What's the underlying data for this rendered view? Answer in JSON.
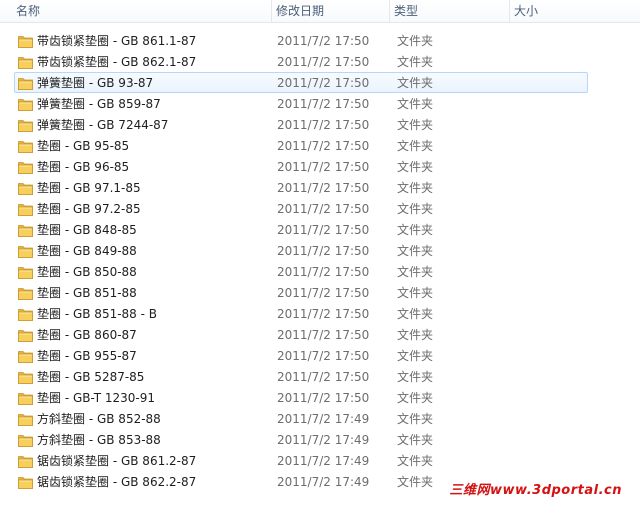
{
  "columns": {
    "name": "名称",
    "date": "修改日期",
    "type": "类型",
    "size": "大小"
  },
  "colors": {
    "folder": "#f3c44a",
    "selection_border": "#b8d6fb",
    "header_text": "#4c607a",
    "watermark": "#d31212"
  },
  "selected_index": 2,
  "rows": [
    {
      "name": "带齿锁紧垫圈 - GB 861.1-87",
      "date": "2011/7/2 17:50",
      "type": "文件夹"
    },
    {
      "name": "带齿锁紧垫圈 - GB 862.1-87",
      "date": "2011/7/2 17:50",
      "type": "文件夹"
    },
    {
      "name": "弹簧垫圈 - GB 93-87",
      "date": "2011/7/2 17:50",
      "type": "文件夹"
    },
    {
      "name": "弹簧垫圈 - GB 859-87",
      "date": "2011/7/2 17:50",
      "type": "文件夹"
    },
    {
      "name": "弹簧垫圈 - GB 7244-87",
      "date": "2011/7/2 17:50",
      "type": "文件夹"
    },
    {
      "name": "垫圈 - GB 95-85",
      "date": "2011/7/2 17:50",
      "type": "文件夹"
    },
    {
      "name": "垫圈 - GB 96-85",
      "date": "2011/7/2 17:50",
      "type": "文件夹"
    },
    {
      "name": "垫圈 - GB 97.1-85",
      "date": "2011/7/2 17:50",
      "type": "文件夹"
    },
    {
      "name": "垫圈 - GB 97.2-85",
      "date": "2011/7/2 17:50",
      "type": "文件夹"
    },
    {
      "name": "垫圈 - GB 848-85",
      "date": "2011/7/2 17:50",
      "type": "文件夹"
    },
    {
      "name": "垫圈 - GB 849-88",
      "date": "2011/7/2 17:50",
      "type": "文件夹"
    },
    {
      "name": "垫圈 - GB 850-88",
      "date": "2011/7/2 17:50",
      "type": "文件夹"
    },
    {
      "name": "垫圈 - GB 851-88",
      "date": "2011/7/2 17:50",
      "type": "文件夹"
    },
    {
      "name": "垫圈 - GB 851-88 - B",
      "date": "2011/7/2 17:50",
      "type": "文件夹"
    },
    {
      "name": "垫圈 - GB 860-87",
      "date": "2011/7/2 17:50",
      "type": "文件夹"
    },
    {
      "name": "垫圈 - GB 955-87",
      "date": "2011/7/2 17:50",
      "type": "文件夹"
    },
    {
      "name": "垫圈 - GB 5287-85",
      "date": "2011/7/2 17:50",
      "type": "文件夹"
    },
    {
      "name": "垫圈 - GB-T 1230-91",
      "date": "2011/7/2 17:50",
      "type": "文件夹"
    },
    {
      "name": "方斜垫圈 - GB 852-88",
      "date": "2011/7/2 17:49",
      "type": "文件夹"
    },
    {
      "name": "方斜垫圈 - GB 853-88",
      "date": "2011/7/2 17:49",
      "type": "文件夹"
    },
    {
      "name": "锯齿锁紧垫圈 - GB 861.2-87",
      "date": "2011/7/2 17:49",
      "type": "文件夹"
    },
    {
      "name": "锯齿锁紧垫圈 - GB 862.2-87",
      "date": "2011/7/2 17:49",
      "type": "文件夹"
    }
  ],
  "watermark": "三维网www.3dportal.cn"
}
